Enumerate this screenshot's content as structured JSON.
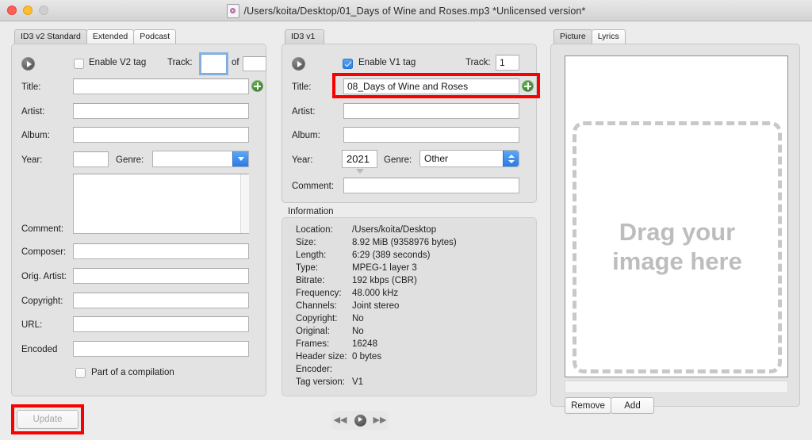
{
  "window": {
    "title": "/Users/koita/Desktop/01_Days of Wine and Roses.mp3 *Unlicensed version*",
    "icon": "mp3-file-icon",
    "buttons": {
      "close": "close-button",
      "minimize": "minimize-button",
      "zoom": "zoom-button"
    }
  },
  "left_panel": {
    "tabs": [
      {
        "label": "ID3 v2 Standard",
        "active": true
      },
      {
        "label": "Extended",
        "active": false
      },
      {
        "label": "Podcast",
        "active": false
      }
    ],
    "enable_label": "Enable V2 tag",
    "enable_checked": false,
    "track_label": "Track:",
    "track_value": "",
    "of_label": "of",
    "of_value": "",
    "fields": [
      {
        "label": "Title:",
        "value": ""
      },
      {
        "label": "Artist:",
        "value": ""
      },
      {
        "label": "Album:",
        "value": ""
      }
    ],
    "year_label": "Year:",
    "year_value": "",
    "genre_label": "Genre:",
    "genre_value": "",
    "comment_label": "Comment:",
    "comment_value": "",
    "more_fields": [
      {
        "label": "Composer:",
        "value": ""
      },
      {
        "label": "Orig. Artist:",
        "value": ""
      },
      {
        "label": "Copyright:",
        "value": ""
      },
      {
        "label": "URL:",
        "value": ""
      },
      {
        "label": "Encoded",
        "value": ""
      }
    ],
    "compilation_label": "Part of a compilation",
    "compilation_checked": false
  },
  "middle_panel": {
    "tabs": [
      {
        "label": "ID3 v1",
        "active": true
      }
    ],
    "enable_label": "Enable V1 tag",
    "enable_checked": true,
    "track_label": "Track:",
    "track_value": "1",
    "fields": [
      {
        "label": "Title:",
        "value": "08_Days of Wine and Roses"
      },
      {
        "label": "Artist:",
        "value": ""
      },
      {
        "label": "Album:",
        "value": ""
      }
    ],
    "year_label": "Year:",
    "year_value": "2021",
    "genre_label": "Genre:",
    "genre_value": "Other",
    "comment_label": "Comment:",
    "comment_value": ""
  },
  "information": {
    "title": "Information",
    "rows": [
      {
        "label": "Location:",
        "value": "/Users/koita/Desktop"
      },
      {
        "label": "Size:",
        "value": "8.92 MiB (9358976 bytes)"
      },
      {
        "label": "Length:",
        "value": "6:29 (389 seconds)"
      },
      {
        "label": "Type:",
        "value": "MPEG-1 layer 3"
      },
      {
        "label": "Bitrate:",
        "value": "192 kbps (CBR)"
      },
      {
        "label": "Frequency:",
        "value": "48.000 kHz"
      },
      {
        "label": "Channels:",
        "value": "Joint stereo"
      },
      {
        "label": "Copyright:",
        "value": "No"
      },
      {
        "label": "Original:",
        "value": "No"
      },
      {
        "label": "Frames:",
        "value": "16248"
      },
      {
        "label": "Header size:",
        "value": "0 bytes"
      },
      {
        "label": "Encoder:",
        "value": ""
      },
      {
        "label": "Tag version:",
        "value": "V1"
      }
    ]
  },
  "right_panel": {
    "tabs": [
      {
        "label": "Picture",
        "active": true
      },
      {
        "label": "Lyrics",
        "active": false
      }
    ],
    "dropzone_line1": "Drag your",
    "dropzone_line2": "image here",
    "path_value": "",
    "remove_label": "Remove",
    "add_label": "Add"
  },
  "footer": {
    "update_label": "Update",
    "update_disabled": true,
    "transport": {
      "prev": "rewind-icon",
      "play": "play-icon",
      "next": "fast-forward-icon"
    }
  },
  "colors": {
    "accent_blue": "#2b7ae4",
    "highlight_red": "#fb0000",
    "green_add": "#2f7a2a",
    "panel_bg": "#e3e3e3",
    "window_bg": "#ececec"
  }
}
